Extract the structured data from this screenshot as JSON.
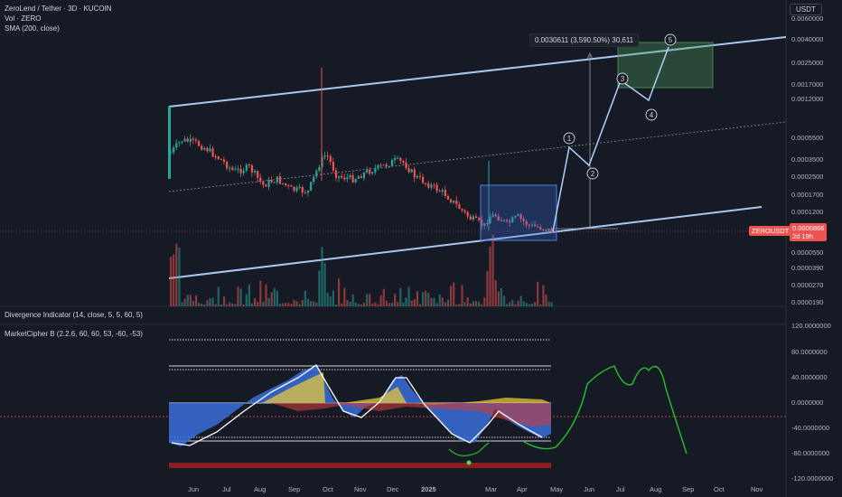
{
  "header": {
    "line1": "ZeroLend / Tether · 3D · KUCOIN",
    "line2": "Vol · ZERO",
    "line3": "SMA (200, close)"
  },
  "indicators": {
    "divergence": "Divergence Indicator (14, close, 5, 5, 60, 5)",
    "cipher": "MarketCipher B (2.2.6, 60, 60, 53, -60, -53)"
  },
  "currency_button": "USDT",
  "price_axis": [
    "0.0060000",
    "0.0040000",
    "0.0025000",
    "0.0017000",
    "0.0012000",
    "0.0005500",
    "0.0003500",
    "0.0002500",
    "0.0001700",
    "0.0001200",
    "0.0000550",
    "0.0000390",
    "0.0000270",
    "0.0000190"
  ],
  "osc_axis": [
    "120.0000000",
    "80.0000000",
    "40.0000000",
    "0.0000000",
    "-40.0000000",
    "-80.0000000",
    "-120.0000000"
  ],
  "time_axis": [
    "Jun",
    "Jul",
    "Aug",
    "Sep",
    "Oct",
    "Nov",
    "Dec",
    "2025",
    "Mar",
    "Apr",
    "May",
    "Jun",
    "Jul",
    "Aug",
    "Sep",
    "Oct",
    "Nov"
  ],
  "symbol_tag": "ZEROUSDT",
  "price_tag": "0.0000866",
  "price_tag_sub": "2d 19h",
  "measure": "0.0030611 (3,590.50%) 30,611",
  "waves": [
    "1",
    "2",
    "3",
    "4",
    "5"
  ],
  "colors": {
    "up": "#26a69a",
    "down": "#ef5350",
    "channel": "#a8c8f0",
    "bg": "#161a25"
  }
}
